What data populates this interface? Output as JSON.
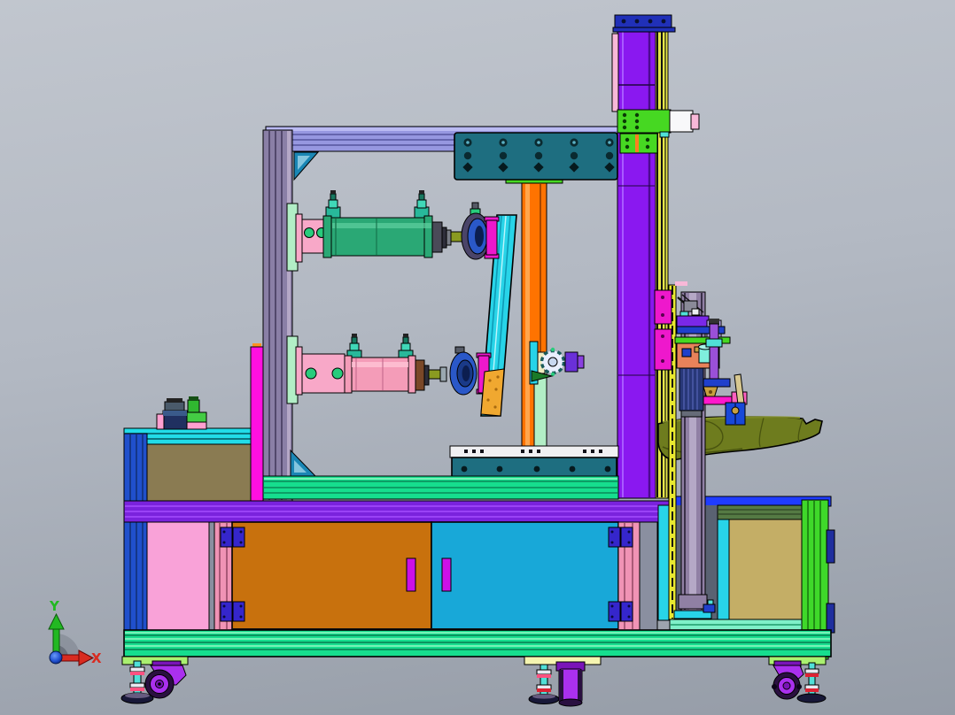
{
  "scene": {
    "type": "cad-3d-viewport-side-view",
    "background": {
      "bg_top": "#c1c6ce",
      "bg_mid": "#b3b9c3",
      "bg_bottom": "#959ca7"
    }
  },
  "triad": {
    "x_label": "X",
    "y_label": "Y",
    "colors": {
      "axis_red": "#d92b20",
      "axis_green": "#22b822",
      "axis_blue": "#2050d0",
      "axis_arc": "#878d97",
      "axis_arc_dark": "#6b717c"
    }
  },
  "palette": {
    "beam": "#9697e0",
    "beam_light": "#babaf2",
    "beam_dark": "#55559e",
    "frame_post": "#8a7fa6",
    "frame_post_dark": "#453a5e",
    "frame_post_light": "#b5a8c6",
    "gusset_teal": "#1a86b4",
    "plate_teal": "#1e6e80",
    "plate_strip": "#f0f0f2",
    "col_purple": "#8a18f0",
    "col_purple_light": "#a85aff",
    "col_purple_dark": "#4c0a90",
    "cap_blue": "#2030b8",
    "rail_yellow": "#e6e64a",
    "carriage_green": "#46d822",
    "white_box": "#f8f8fa",
    "pink_soft": "#f8b8d8",
    "orange_col": "#ff7300",
    "orange_col_light": "#ffa64d",
    "mint_plate": "#b2eec6",
    "cyl_green": "#2aa875",
    "cyl_green_light": "#5fd0a0",
    "cyl_green_dark": "#17754e",
    "cyl_pink": "#f49cb8",
    "cyl_pink_light": "#ffc4d6",
    "clevis_pink": "#f8a8c8",
    "pin_green": "#28cc7c",
    "fitting_teal": "#28b89a",
    "fitting_teal_light": "#40d8b8",
    "fitting_dark": "#187860",
    "rod_olive": "#8a9a20",
    "rod_end_gray": "#4a4a58",
    "rod_end_brown": "#7a4828",
    "coupler_gray": "#9aa8b0",
    "bell_blue": "#2a58c8",
    "bell_slate": "#4a4468",
    "bell_core": "#0c1e50",
    "flange_magenta": "#ee18cc",
    "sponge_orange": "#f0a830",
    "sponge_dot": "#a86a10",
    "tilt_cyan": "#28d4e8",
    "tilt_cyan_dark": "#0f9ab6",
    "rotary_white": "#e9efff",
    "rotary_ring": "#1a5a5a",
    "rotary_hub": "#c8d8f0",
    "pale_block": "#f0ecc0",
    "violet_block": "#6a30d8",
    "violet_light": "#8a40e0",
    "wedge_green": "#1a7a28",
    "table_cyan": "#22dce8",
    "post_blue": "#2050cc",
    "post_blue_dark": "#123078",
    "khaki_left": "#8a7b52",
    "khaki_right": "#c4ae66",
    "magenta_post": "#ff10e0",
    "magenta_tip": "#ff9020",
    "table_beam_purple": "#7a22dd",
    "table_beam_light": "#a44dff",
    "edge_blue": "#1f3cff",
    "door_orange": "#c8710d",
    "door_cyan": "#18a8d8",
    "door_pink_post": "#f093b5",
    "panel_pink": "#f9a2d8",
    "hinge_purple": "#3526cc",
    "handle_magenta": "#cc10e8",
    "slate_strip": "#8a8fa0",
    "rail_emerald": "#16de8e",
    "rail_emerald_dark": "#0a8a58",
    "rail_emerald_light": "#b0ffd0",
    "rail_mint": "#7ff0c8",
    "leg_green": "#3fd82a",
    "leg_green_dark": "#187a10",
    "rail_olive": "#557a44",
    "bay_slate": "#5a6272",
    "slide_mauve": "#9080a4",
    "slide_mauve_light": "#b5a8c6",
    "slide_mauve_dark": "#3a3048",
    "foot_plate_green": "#aaf070",
    "foot_plate_yellow": "#f5f5b0",
    "caster_purple": "#7a14b8",
    "caster_rim": "#aa30ee",
    "caster_dark": "#2a1040",
    "stem_cyan": "#50e0d8",
    "collar_white": "#e8e8f0",
    "collar_pink": "#ff5080",
    "collar_red": "#dd2233",
    "foot_pad": "#181838",
    "assy_salmon": "#e8825a",
    "assy_blue": "#2040cc",
    "assy_purple": "#7a28e8",
    "assy_navy": "#283878",
    "assy_navy_rib": "#4a5aa8",
    "assy_cyan": "#7feedd",
    "tube_purple": "#9a50d8",
    "bar_magenta": "#ff18cc",
    "bar_pink": "#ff60c0",
    "clamp_blue": "#1848d8",
    "lever_tan": "#d8c890",
    "pad_khaki": "#c8a040",
    "strip_yellow": "#e8e830",
    "lavender_block": "#b4a6e6",
    "gray_block": "#8a8a98",
    "olive_part": "#6e7c1e",
    "olive_dark": "#49540f",
    "olive_light": "#8e9c2e",
    "device_navy": "#203060",
    "device_green": "#44cc44",
    "device_pink": "#ffa0d0",
    "device_gray": "#4a5a6a",
    "axis_red": "#d92b20",
    "axis_green": "#22b822",
    "axis_arc": "#878d97",
    "axis_arc_dark": "#6b717c"
  }
}
